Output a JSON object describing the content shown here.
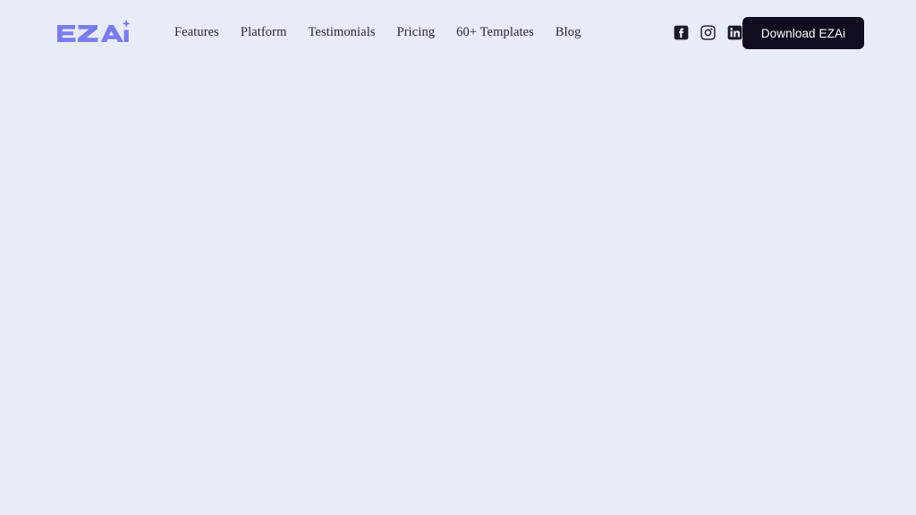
{
  "page": {
    "background_color": "#e8ecf9",
    "main_region_empty": true
  },
  "header": {
    "logo": {
      "text": "EZAi",
      "icon": "sparkle-icon",
      "color": "#7b7bf0"
    },
    "nav": {
      "items": [
        {
          "label": "Features"
        },
        {
          "label": "Platform"
        },
        {
          "label": "Testimonials"
        },
        {
          "label": "Pricing"
        },
        {
          "label": "60+ Templates"
        },
        {
          "label": "Blog"
        }
      ]
    },
    "socials": [
      {
        "name": "facebook-icon"
      },
      {
        "name": "instagram-icon"
      },
      {
        "name": "linkedin-icon"
      }
    ],
    "cta": {
      "label": "Download EZAi",
      "background_color": "#120c20",
      "text_color": "#ffffff"
    }
  }
}
